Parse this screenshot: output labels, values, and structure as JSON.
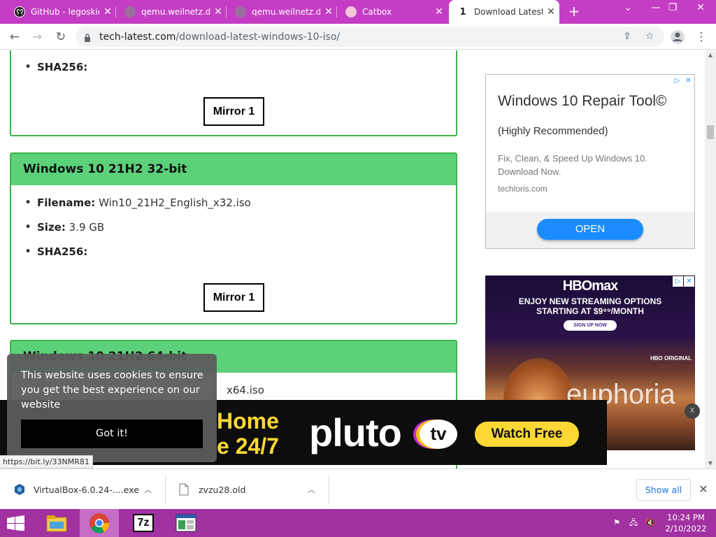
{
  "browser": {
    "tabs": [
      {
        "title": "GitHub - legoskid",
        "favicon": "github-icon"
      },
      {
        "title": "qemu.weilnetz.de",
        "favicon": "globe-icon"
      },
      {
        "title": "qemu.weilnetz.de",
        "favicon": "globe-icon"
      },
      {
        "title": "Catbox",
        "favicon": "catbox-icon"
      },
      {
        "title": "Download Latest",
        "favicon": "techlatest-icon",
        "active": true
      }
    ],
    "new_tab": "+",
    "window_controls": {
      "tab_search": "⌄",
      "minimize": "—",
      "restore": "❐",
      "close": "✕"
    },
    "url_host": "tech-latest.com",
    "url_path": "/download-latest-windows-10-iso/"
  },
  "content": {
    "card1": {
      "sha_label": "SHA256:",
      "mirror_label": "Mirror 1"
    },
    "card2": {
      "title": "Windows 10 21H2 32-bit",
      "filename_label": "Filename:",
      "filename": "Win10_21H2_English_x32.iso",
      "size_label": "Size:",
      "size": "3.9 GB",
      "sha_label": "SHA256:",
      "mirror_label": "Mirror 1"
    },
    "card3": {
      "title": "Windows 10 21H2 64-bit",
      "filename_partial": "x64.iso"
    }
  },
  "ads": {
    "repair": {
      "title": "Windows 10 Repair Tool©",
      "subtitle": "(Highly Recommended)",
      "body": "Fix, Clean, & Speed Up Windows 10. Download Now.",
      "domain": "techloris.com",
      "cta": "OPEN"
    },
    "hbo": {
      "logo": "HBOmax",
      "line1": "ENJOY NEW STREAMING OPTIONS",
      "line2": "STARTING AT $9⁹⁹/MONTH",
      "cta": "SIGN UP NOW",
      "badge": "HBO ORIGINAL",
      "show": "euphoria"
    },
    "pluto": {
      "live1": "Home",
      "live2": "e 24/7",
      "brand": "pluto",
      "tv": "tv",
      "cta": "Watch Free",
      "close": "X"
    }
  },
  "cookie": {
    "message": "This website uses cookies to ensure you get the best experience on our website",
    "button": "Got it!"
  },
  "status_url": "https://bit.ly/33NMR81",
  "downloads": {
    "items": [
      {
        "name": "VirtualBox-6.0.24-....exe",
        "icon": "virtualbox-icon"
      },
      {
        "name": "zvzu28.old",
        "icon": "file-icon"
      }
    ],
    "show_all": "Show all"
  },
  "taskbar": {
    "apps": [
      "file-explorer-icon",
      "chrome-icon",
      "7zip-icon",
      "window-app-icon"
    ],
    "time": "10:24 PM",
    "date": "2/10/2022"
  }
}
